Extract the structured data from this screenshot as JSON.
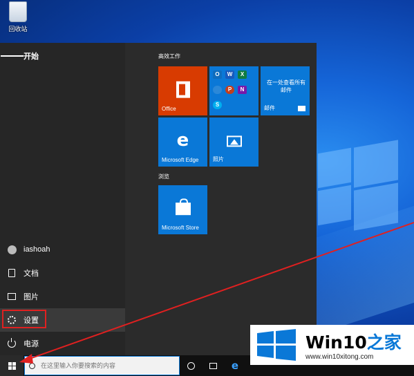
{
  "desktop": {
    "recycle_bin_label": "回收站"
  },
  "start_menu": {
    "title": "开始",
    "rail": {
      "user": "iashoah",
      "documents": "文档",
      "pictures": "图片",
      "settings": "设置",
      "power": "电源"
    },
    "groups": [
      {
        "label": "高效工作"
      },
      {
        "label": "浏览"
      }
    ],
    "tiles": {
      "office": "Office",
      "mail_promo": "在一处查看所有邮件",
      "mail": "邮件",
      "edge": "Microsoft Edge",
      "photos": "照片",
      "store": "Microsoft Store"
    },
    "mini_apps": [
      "O",
      "W",
      "X",
      "P",
      "N",
      "S"
    ]
  },
  "taskbar": {
    "search_placeholder": "在这里输入你要搜索的内容"
  },
  "watermark": {
    "title_prefix": "Win10",
    "title_suffix": "之家",
    "url": "www.win10xitong.com"
  },
  "colors": {
    "tile_blue": "#0a78d7",
    "office_red": "#d83b01",
    "highlight_red": "#e02020"
  }
}
